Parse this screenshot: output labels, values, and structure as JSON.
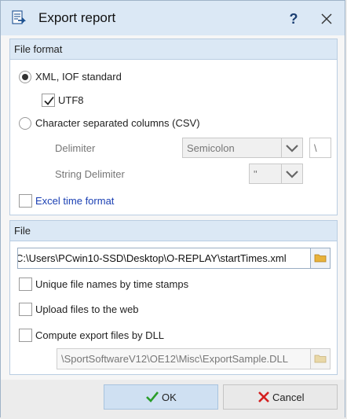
{
  "window": {
    "title": "Export report",
    "help_label": "?"
  },
  "file_format": {
    "header": "File format",
    "xml_label": "XML, IOF standard",
    "xml_selected": true,
    "utf8_label": "UTF8",
    "utf8_checked": true,
    "csv_label": "Character separated columns (CSV)",
    "csv_selected": false,
    "delimiter_label": "Delimiter",
    "delimiter_value": "Semicolon",
    "delimiter_char": "\\",
    "string_delimiter_label": "String Delimiter",
    "string_delimiter_value": "\"",
    "excel_time_label": "Excel time format",
    "excel_time_checked": false
  },
  "file": {
    "header": "File",
    "path_value": "C:\\Users\\PCwin10-SSD\\Desktop\\O-REPLAY\\startTimes.xml",
    "unique_names_label": "Unique file names by time stamps",
    "upload_label": "Upload files to the web",
    "dll_label": "Compute export files by DLL",
    "dll_path_value": "\\SportSoftwareV12\\OE12\\Misc\\ExportSample.DLL"
  },
  "buttons": {
    "ok_label": "OK",
    "cancel_label": "Cancel"
  },
  "colors": {
    "accent": "#dbe8f5",
    "ok_check": "#2a9d2a",
    "cancel_x": "#d42020",
    "link_blue": "#1a3fb3",
    "folder": "#e8b23a"
  },
  "icons": {
    "title": "report-icon",
    "close": "close-icon",
    "folder": "folder-icon"
  }
}
